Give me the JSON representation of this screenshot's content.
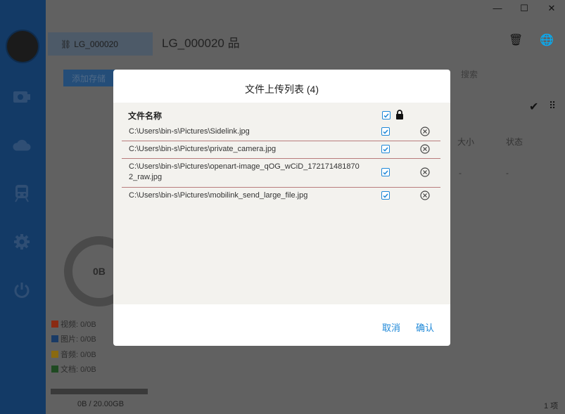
{
  "window": {
    "minimize_icon": "minimize-icon",
    "maximize_icon": "maximize-icon",
    "close_icon": "close-icon"
  },
  "sidebar": {
    "items": [
      {
        "icon": "camera-icon"
      },
      {
        "icon": "cloud-icon"
      },
      {
        "icon": "train-icon"
      },
      {
        "icon": "gear-icon"
      },
      {
        "icon": "power-icon"
      }
    ]
  },
  "device": {
    "card_label": "LG_000020",
    "title": "LG_000020 品"
  },
  "toolbar": {
    "add_storage_label": "添加存储",
    "search_placeholder": "搜索"
  },
  "table": {
    "columns": [
      "大小",
      "状态"
    ],
    "row_values": [
      "-",
      "-"
    ],
    "item_count": "1 项"
  },
  "storage": {
    "donut_label": "0B",
    "legend": [
      {
        "label": "视频: 0/0B",
        "color": "#8a2a12"
      },
      {
        "label": "图片: 0/0B",
        "color": "#1a3b66"
      },
      {
        "label": "音频: 0/0B",
        "color": "#8a6a10"
      },
      {
        "label": "文档: 0/0B",
        "color": "#1f4a22"
      }
    ],
    "usage_text": "0B / 20.00GB",
    "usage_fraction": 0
  },
  "modal": {
    "title": "文件上传列表 (4)",
    "column_header": "文件名称",
    "files": [
      {
        "path": "C:\\Users\\bin-s\\Pictures\\Sidelink.jpg",
        "checked": true
      },
      {
        "path": "C:\\Users\\bin-s\\Pictures\\private_camera.jpg",
        "checked": true
      },
      {
        "path": "C:\\Users\\bin-s\\Pictures\\openart-image_qOG_wCiD_1721714818702_raw.jpg",
        "checked": true
      },
      {
        "path": "C:\\Users\\bin-s\\Pictures\\mobilink_send_large_file.jpg",
        "checked": true
      }
    ],
    "cancel_label": "取消",
    "confirm_label": "确认"
  },
  "colors": {
    "accent": "#1e88d8",
    "sidebar": "#133a66",
    "row_divider": "#b87c7c"
  }
}
